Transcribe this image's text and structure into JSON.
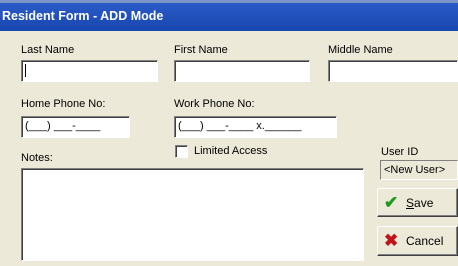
{
  "window": {
    "title": "Resident Form - ADD Mode"
  },
  "fields": {
    "last_name": {
      "label": "Last Name",
      "value": ""
    },
    "first_name": {
      "label": "First Name",
      "value": ""
    },
    "middle_name": {
      "label": "Middle Name",
      "value": ""
    },
    "home_phone": {
      "label": "Home Phone No:",
      "value": "(___) ___-____"
    },
    "work_phone": {
      "label": "Work Phone No:",
      "value": "(___) ___-____ x.______"
    },
    "notes": {
      "label": "Notes:",
      "value": ""
    }
  },
  "limited_access": {
    "label": "Limited Access",
    "checked": false
  },
  "user": {
    "label": "User ID",
    "value": "<New User>"
  },
  "buttons": {
    "save": {
      "mnemonic": "S",
      "rest": "ave",
      "icon": "checkmark-icon"
    },
    "cancel": {
      "label": "Cancel",
      "icon": "x-icon"
    }
  },
  "colors": {
    "titlebar": "#1846b0",
    "background": "#ece9d8",
    "save_icon": "#1f9a1f",
    "cancel_icon": "#c0141a"
  }
}
